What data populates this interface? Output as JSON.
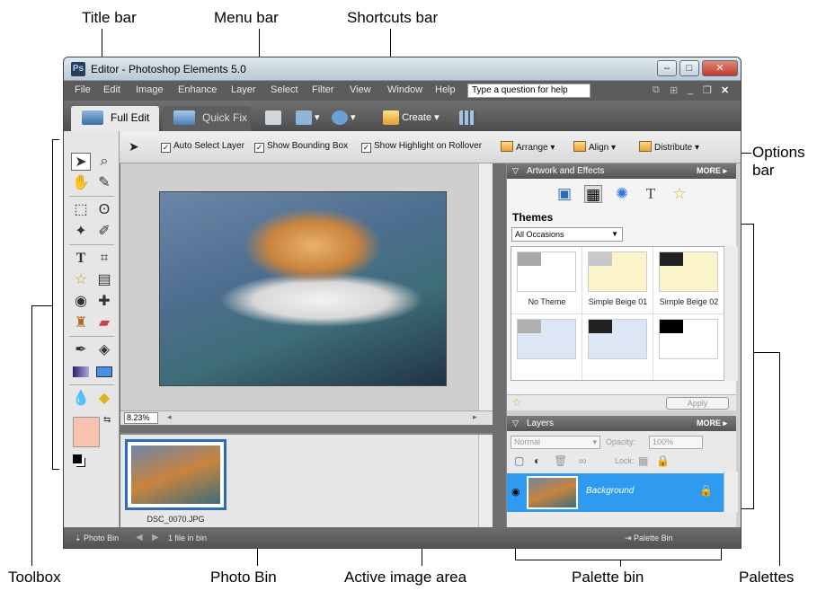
{
  "callouts": {
    "title_bar": "Title bar",
    "menu_bar": "Menu bar",
    "shortcuts_bar": "Shortcuts bar",
    "options_bar": "Options bar",
    "toolbox": "Toolbox",
    "photo_bin": "Photo Bin",
    "active_image_area": "Active image area",
    "palette_bin": "Palette bin",
    "palettes": "Palettes"
  },
  "window": {
    "title": "Editor - Photoshop Elements 5.0",
    "controls": {
      "minimize": "–",
      "maximize": "□",
      "close": "✕"
    }
  },
  "menu": {
    "items": [
      "File",
      "Edit",
      "Image",
      "Enhance",
      "Layer",
      "Select",
      "Filter",
      "View",
      "Window",
      "Help"
    ],
    "help_placeholder": "Type a question for help"
  },
  "shortcuts": {
    "tab_full_edit": "Full Edit",
    "tab_quick_fix": "Quick Fix",
    "create": "Create ▾"
  },
  "options": {
    "auto_select": "Auto Select Layer",
    "show_bbox": "Show Bounding Box",
    "show_highlight": "Show Highlight on Rollover",
    "arrange": "Arrange ▾",
    "align": "Align ▾",
    "distribute": "Distribute ▾"
  },
  "image_area": {
    "zoom": "8.23%"
  },
  "photo_bin": {
    "filename": "DSC_0070.JPG"
  },
  "artwork": {
    "title": "Artwork and Effects",
    "more": "MORE ▸",
    "themes_title": "Themes",
    "occasion": "All Occasions",
    "themes": [
      {
        "label": "No Theme",
        "bg": "#ffffff",
        "accent": "#a8a8a8"
      },
      {
        "label": "Simple Beige 01",
        "bg": "#fbf3c9",
        "accent": "#c8c8c8"
      },
      {
        "label": "Simple Beige 02",
        "bg": "#fbf3c9",
        "accent": "#222222"
      },
      {
        "label": "",
        "bg": "#dde6f4",
        "accent": "#b0b0b0"
      },
      {
        "label": "",
        "bg": "#dde6f4",
        "accent": "#222222"
      },
      {
        "label": "",
        "bg": "#ffffff",
        "accent": "#000000"
      }
    ],
    "apply": "Apply"
  },
  "layers": {
    "title": "Layers",
    "more": "MORE ▸",
    "blend_mode": "Normal",
    "opacity_label": "Opacity:",
    "opacity_value": "100%",
    "lock_label": "Lock:",
    "layer_name": "Background"
  },
  "status": {
    "photo_bin": "Photo Bin",
    "file_count": "1 file in bin",
    "palette_bin": "Palette Bin"
  }
}
